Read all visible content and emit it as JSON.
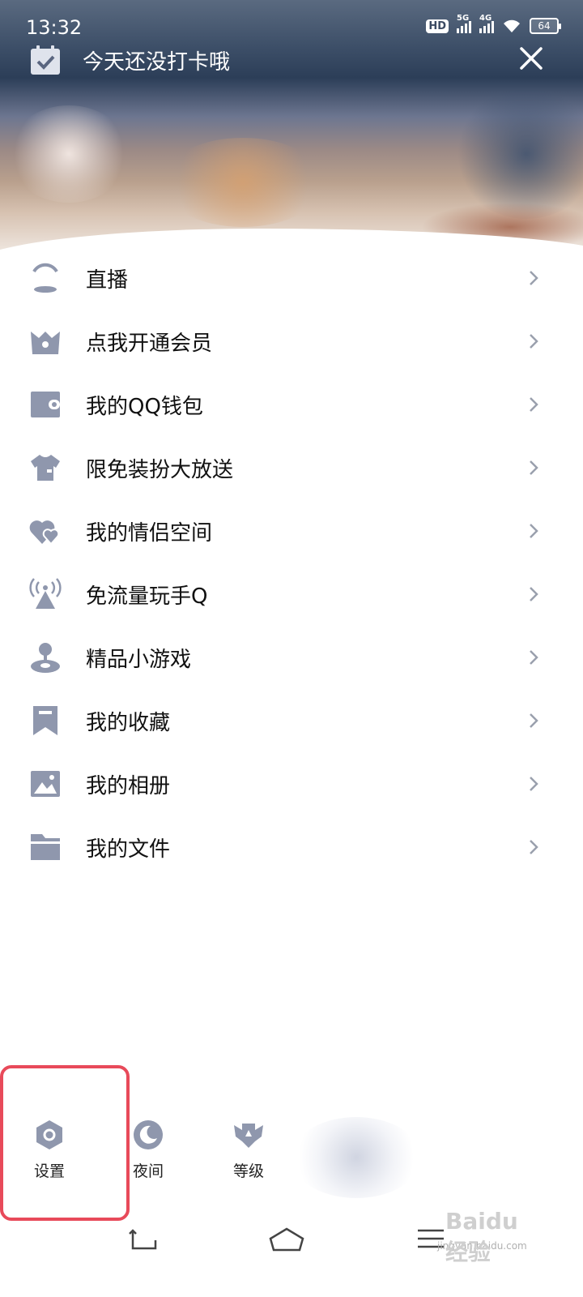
{
  "status_bar": {
    "time": "13:32",
    "hd": "HD",
    "sig1_label": "5G",
    "sig2_label": "4G",
    "battery": "64"
  },
  "checkin": {
    "text": "今天还没打卡哦",
    "icon": "calendar-check-icon"
  },
  "menu": {
    "items": [
      {
        "label": "直播",
        "icon": "live-icon"
      },
      {
        "label": "点我开通会员",
        "icon": "crown-icon"
      },
      {
        "label": "我的QQ钱包",
        "icon": "wallet-icon"
      },
      {
        "label": "限免装扮大放送",
        "icon": "tshirt-icon"
      },
      {
        "label": "我的情侣空间",
        "icon": "hearts-icon"
      },
      {
        "label": "免流量玩手Q",
        "icon": "signal-tower-icon"
      },
      {
        "label": "精品小游戏",
        "icon": "game-pin-icon"
      },
      {
        "label": "我的收藏",
        "icon": "bookmark-icon"
      },
      {
        "label": "我的相册",
        "icon": "image-icon"
      },
      {
        "label": "我的文件",
        "icon": "folder-icon"
      }
    ]
  },
  "bottom_bar": {
    "settings": "设置",
    "night": "夜间",
    "level": "等级"
  },
  "watermark": {
    "logo": "Baidu经验",
    "url": "jingyan.baidu.com"
  },
  "colors": {
    "icon": "#8f97ad",
    "highlight": "#e84a5a",
    "text": "#111111"
  }
}
